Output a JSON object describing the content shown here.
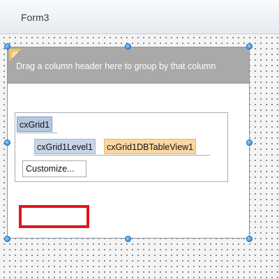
{
  "window": {
    "title": "Form3"
  },
  "grid": {
    "group_panel_text": "Drag a column header here to group by that column",
    "structure": {
      "grid_name": "cxGrid1",
      "level_name": "cxGrid1Level1",
      "view_name": "cxGrid1DBTableView1",
      "customize_label": "Customize..."
    }
  },
  "colors": {
    "group_panel": "#a9a9a9",
    "view_node": "#fbd7a0",
    "level_node": "#c6d5e8",
    "grid_node": "#b5c8e0",
    "highlight": "#e0161d",
    "selection_handle": "#1f7fd3"
  },
  "icons": {
    "corner": "group-by-corner-icon"
  }
}
